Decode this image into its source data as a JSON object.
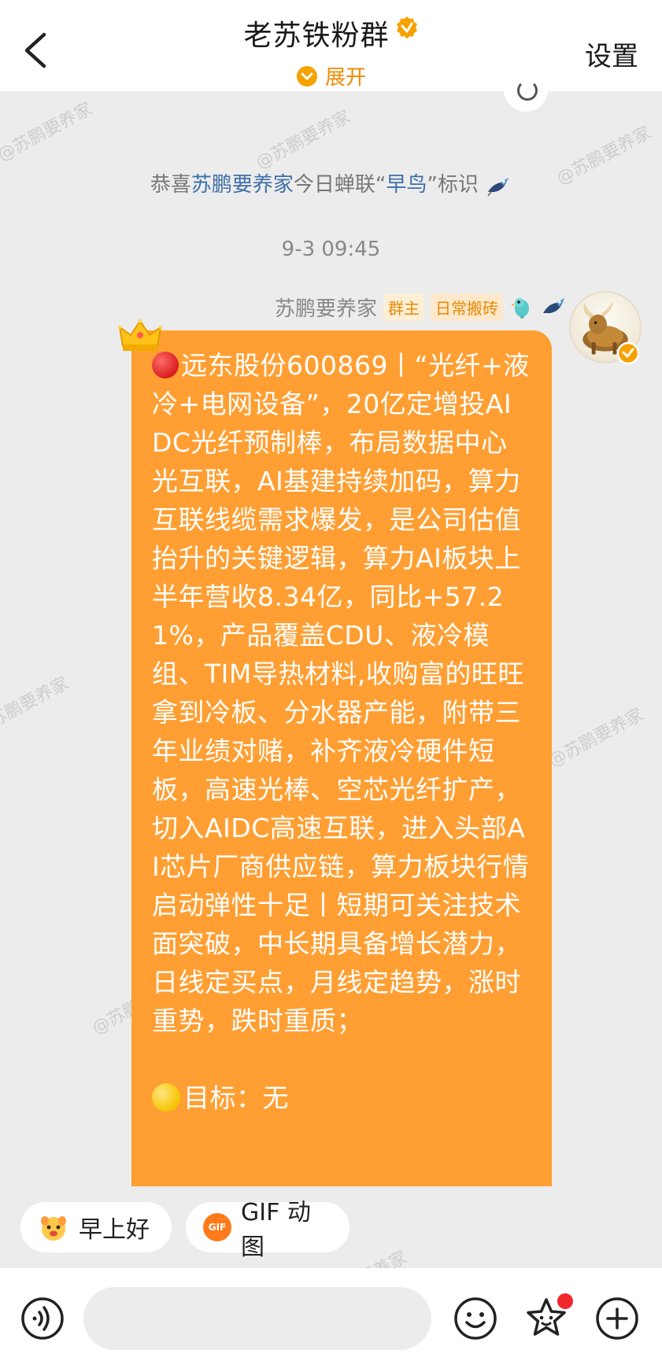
{
  "header": {
    "title": "老苏铁粉群",
    "expand_label": "展开",
    "settings_label": "设置",
    "accent_color": "#f08a00"
  },
  "watermark_text": "@苏鹏要养家",
  "notice": {
    "prefix": "恭喜",
    "user": "苏鹏要养家",
    "middle": "今日蝉联“",
    "badge": "早鸟",
    "suffix": "”标识"
  },
  "timestamp": "9-3 09:45",
  "message": {
    "sender": "苏鹏要养家",
    "tags": [
      "群主",
      "日常搬砖"
    ],
    "bubble_color": "#ff9f33",
    "text_main": "远东股份600869丨“光纤+液冷+电网设备”，20亿定增投AIDC光纤预制棒，布局数据中心光互联，AI基建持续加码，算力互联线缆需求爆发，是公司估值抬升的关键逻辑，算力AI板块上半年营收8.34亿，同比+57.21%，产品覆盖CDU、液冷模组、TIM导热材料,收购富的旺旺拿到冷板、分水器产能，附带三年业绩对赌，补齐液冷硬件短板，高速光棒、空芯光纤扩产，切入AIDC高速互联，进入头部AI芯片厂商供应链，算力板块行情启动弹性十足丨短期可关注技术面突破，中长期具备增长潜力，日线定买点，月线定趋势，涨时重势，跌时重质；",
    "text_target": "目标：无"
  },
  "quick_replies": {
    "morning": "早上好",
    "gif": "GIF 动图",
    "gif_icon_text": "GIF"
  },
  "composer": {
    "placeholder": ""
  }
}
